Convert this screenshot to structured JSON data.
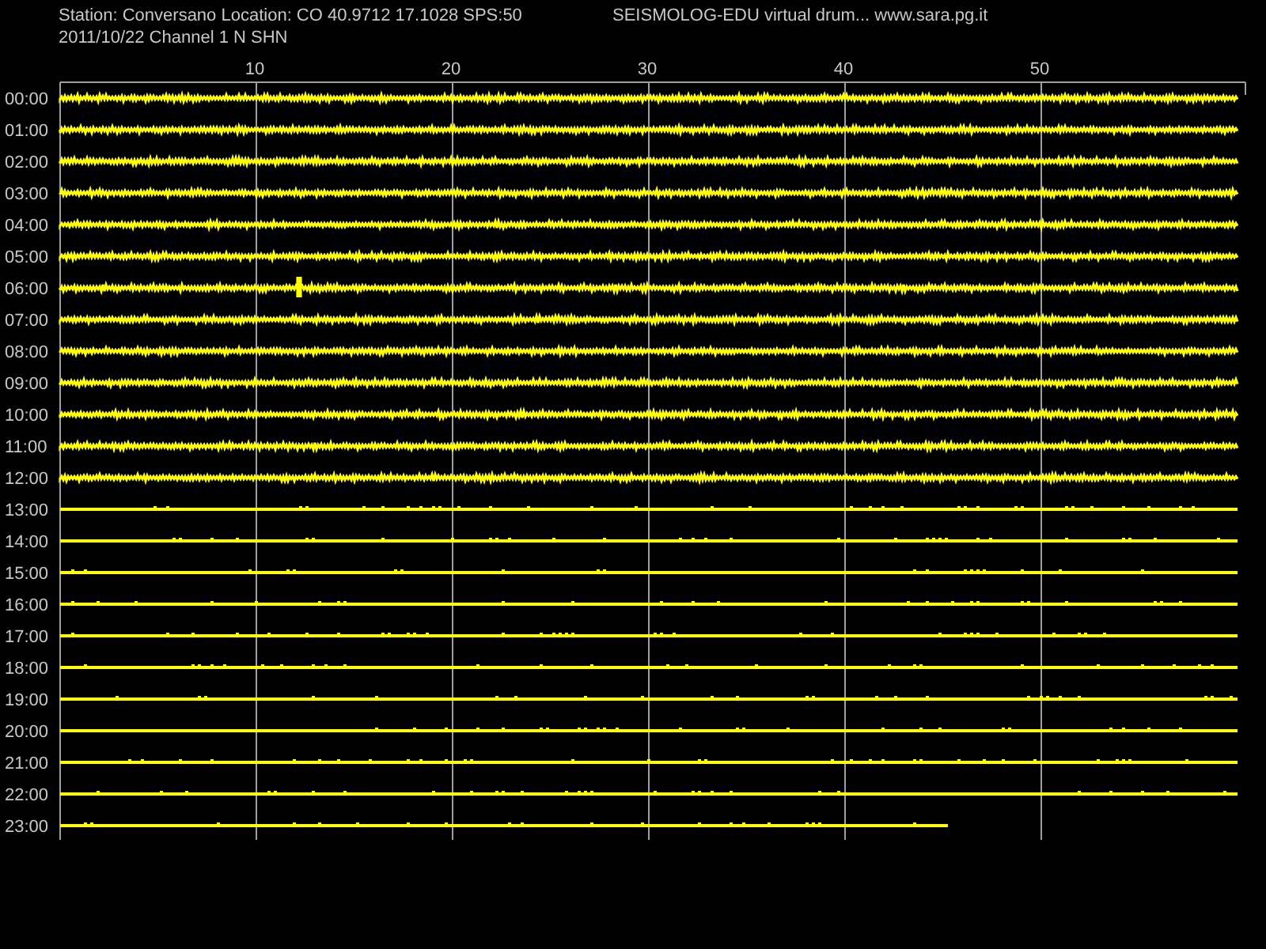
{
  "header": {
    "station": "Station: Conversano Location: CO 40.9712 17.1028 SPS:50",
    "date_channel": "2011/10/22  Channel 1 N SHN",
    "title": "SEISMOLOG-EDU virtual drum... www.sara.pg.it"
  },
  "x_ticks": [
    "10",
    "20",
    "30",
    "40",
    "50"
  ],
  "rows": [
    {
      "time": "00:00",
      "kind": "noisy",
      "level": 1
    },
    {
      "time": "01:00",
      "kind": "noisy",
      "level": 1
    },
    {
      "time": "02:00",
      "kind": "noisy",
      "level": 1
    },
    {
      "time": "03:00",
      "kind": "noisy",
      "level": 1
    },
    {
      "time": "04:00",
      "kind": "noisy",
      "level": 1
    },
    {
      "time": "05:00",
      "kind": "noisy",
      "level": 1
    },
    {
      "time": "06:00",
      "kind": "event",
      "level": 1
    },
    {
      "time": "07:00",
      "kind": "noisy",
      "level": 1
    },
    {
      "time": "08:00",
      "kind": "noisy",
      "level": 1
    },
    {
      "time": "09:00",
      "kind": "noisy",
      "level": 1
    },
    {
      "time": "10:00",
      "kind": "noisy",
      "level": 1
    },
    {
      "time": "11:00",
      "kind": "noisy",
      "level": 1
    },
    {
      "time": "12:00",
      "kind": "noisy",
      "level": 1
    },
    {
      "time": "13:00",
      "kind": "quiet",
      "level": 1
    },
    {
      "time": "14:00",
      "kind": "quiet",
      "level": 1
    },
    {
      "time": "15:00",
      "kind": "quiet",
      "level": 1
    },
    {
      "time": "16:00",
      "kind": "quiet",
      "level": 1
    },
    {
      "time": "17:00",
      "kind": "quiet",
      "level": 1
    },
    {
      "time": "18:00",
      "kind": "quiet",
      "level": 1
    },
    {
      "time": "19:00",
      "kind": "quiet",
      "level": 1
    },
    {
      "time": "20:00",
      "kind": "quiet",
      "level": 1
    },
    {
      "time": "21:00",
      "kind": "quiet",
      "level": 1
    },
    {
      "time": "22:00",
      "kind": "quiet",
      "level": 1
    },
    {
      "time": "23:00",
      "kind": "quiet",
      "level": 0.754
    }
  ]
}
